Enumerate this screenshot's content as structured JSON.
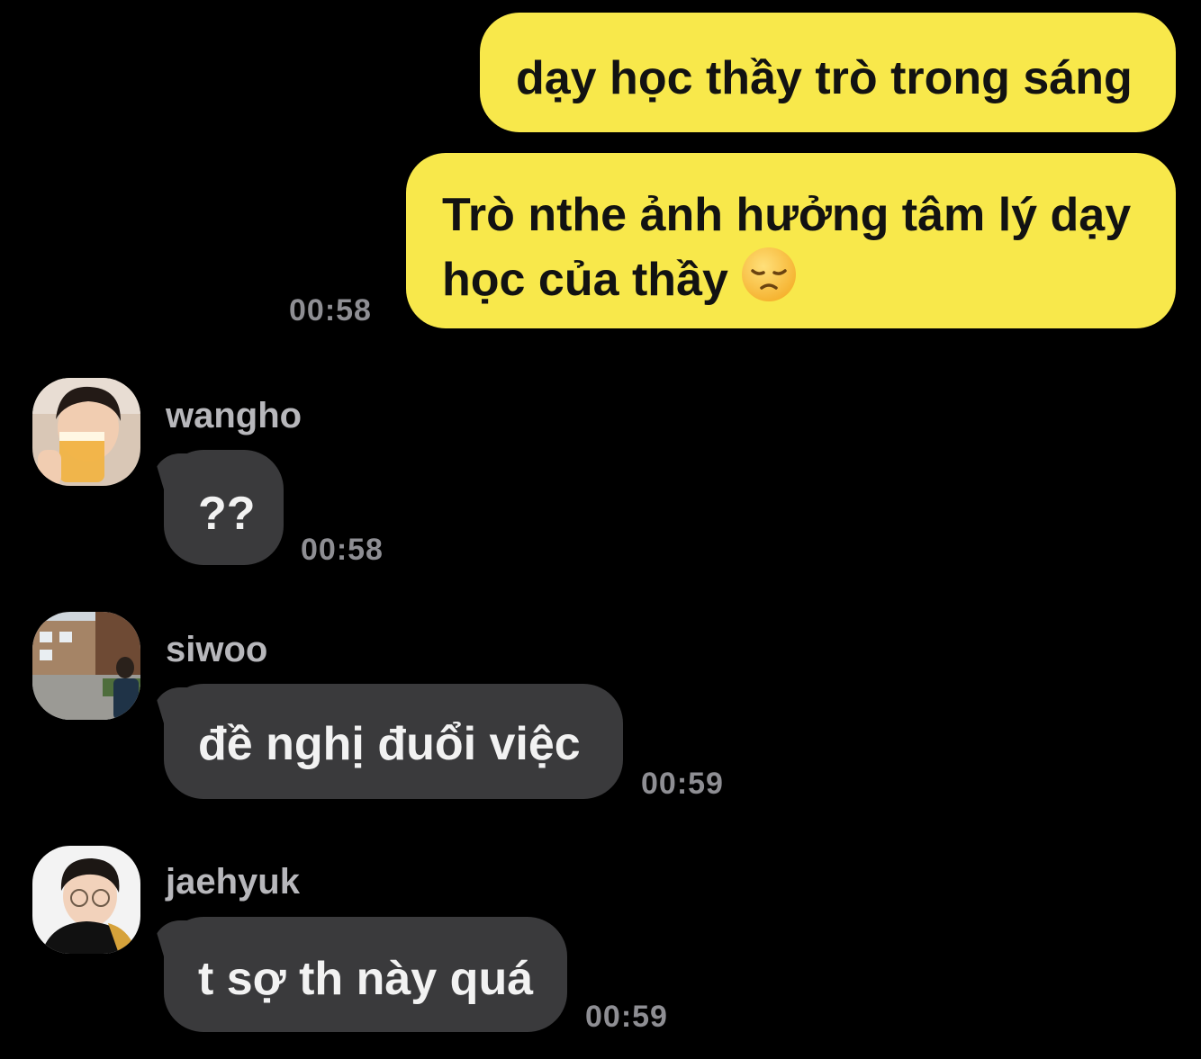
{
  "messages": [
    {
      "sender": "me",
      "text": "dạy học thầy trò trong sáng"
    },
    {
      "sender": "me",
      "text_line1": "Trò nthe ảnh hưởng tâm lý dạy",
      "text_line2": "học của thầy",
      "emoji": "disappointed-face-icon",
      "time": "00:58"
    },
    {
      "sender": "wangho",
      "text": "??",
      "time": "00:58"
    },
    {
      "sender": "siwoo",
      "text": "đề nghị đuổi việc",
      "time": "00:59"
    },
    {
      "sender": "jaehyuk",
      "text": "t sợ th này quá",
      "time": "00:59"
    }
  ],
  "colors": {
    "background": "#000000",
    "outgoing_bubble": "#f8e84b",
    "incoming_bubble": "#3a3a3c",
    "timestamp": "#8e8e93",
    "sender_name": "#b7b7bb"
  }
}
